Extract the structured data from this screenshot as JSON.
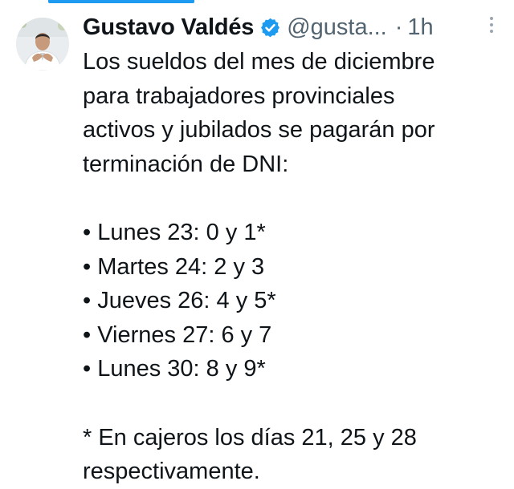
{
  "tweet": {
    "author_name": "Gustavo Valdés",
    "handle": "@gusta...",
    "separator": "·",
    "time": "1h",
    "verified_icon": "verified-badge-icon",
    "more_icon": "more-vertical-icon",
    "text_lines_intro": [
      "Los sueldos del mes de diciembre",
      "para trabajadores provinciales",
      "activos y jubilados se pagarán por",
      "terminación de DNI:"
    ],
    "schedule": [
      "• Lunes 23: 0 y 1*",
      "• Martes 24: 2 y 3",
      "• Jueves 26: 4 y 5*",
      "• Viernes 27: 6 y 7",
      "• Lunes 30: 8 y 9*"
    ],
    "footnote_lines": [
      "* En cajeros los días 21,  25 y 28",
      "respectivamente."
    ]
  },
  "colors": {
    "accent": "#1d9bf0",
    "text": "#0f1419",
    "muted": "#536471"
  }
}
